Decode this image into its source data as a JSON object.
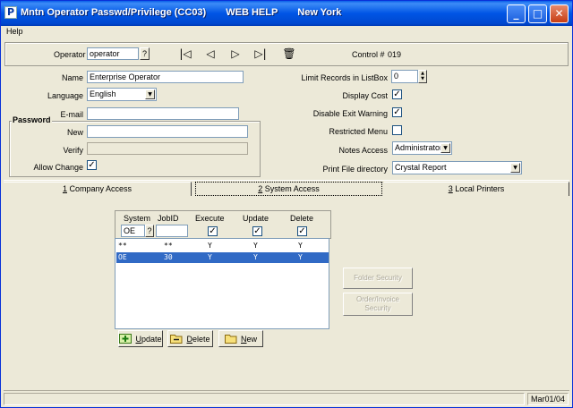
{
  "window": {
    "title": "Mntn Operator Passwd/Privilege (CC03)",
    "title_extra_1": "WEB HELP",
    "title_extra_2": "New York",
    "app_glyph": "P"
  },
  "menu": {
    "help": "Help"
  },
  "toolbar": {
    "operator_label": "Operator",
    "operator_value": "operator",
    "lookup_label": "?",
    "control_label": "Control #",
    "control_value": "019"
  },
  "form": {
    "name_label": "Name",
    "name_value": "Enterprise Operator",
    "language_label": "Language",
    "language_value": "English",
    "email_label": "E-mail",
    "email_value": "",
    "password_group": "Password",
    "new_label": "New",
    "verify_label": "Verify",
    "allow_change_label": "Allow Change",
    "allow_change_checked": "✓",
    "limit_label": "Limit Records in ListBox",
    "limit_value": "0",
    "display_cost_label": "Display Cost",
    "display_cost_checked": "✓",
    "disable_exit_label": "Disable Exit Warning",
    "disable_exit_checked": "✓",
    "restricted_menu_label": "Restricted Menu",
    "restricted_menu_checked": "",
    "notes_access_label": "Notes Access",
    "notes_access_value": "Administrator",
    "print_dir_label": "Print File directory",
    "print_dir_value": "Crystal Report"
  },
  "tabs": [
    {
      "num": "1",
      "label": " Company Access"
    },
    {
      "num": "2",
      "label": " System Access"
    },
    {
      "num": "3",
      "label": " Local Printers"
    }
  ],
  "grid": {
    "headers": [
      "System",
      "JobID",
      "Execute",
      "Update",
      "Delete"
    ],
    "filter_system": "OE",
    "filter_lookup": "?",
    "filter_jobid": "",
    "filter_execute": "✓",
    "filter_update": "✓",
    "filter_delete": "✓",
    "rows": [
      {
        "system": "**",
        "jobid": "**",
        "execute": "Y",
        "update": "Y",
        "delete": "Y"
      },
      {
        "system": "OE",
        "jobid": "30",
        "execute": "Y",
        "update": "Y",
        "delete": "Y"
      }
    ]
  },
  "side_buttons": {
    "folder_security": "Folder Security",
    "order_invoice_1": "Order/Invoice",
    "order_invoice_2": "Security"
  },
  "actions": {
    "update_u": "U",
    "update_rest": "pdate",
    "delete_u": "D",
    "delete_rest": "elete",
    "new_u": "N",
    "new_rest": "ew"
  },
  "status": {
    "message": "",
    "date": "Mar01/04"
  },
  "colors": {
    "titlebar": "#0055e5",
    "selection": "#316ac5",
    "face": "#ece9d8"
  }
}
